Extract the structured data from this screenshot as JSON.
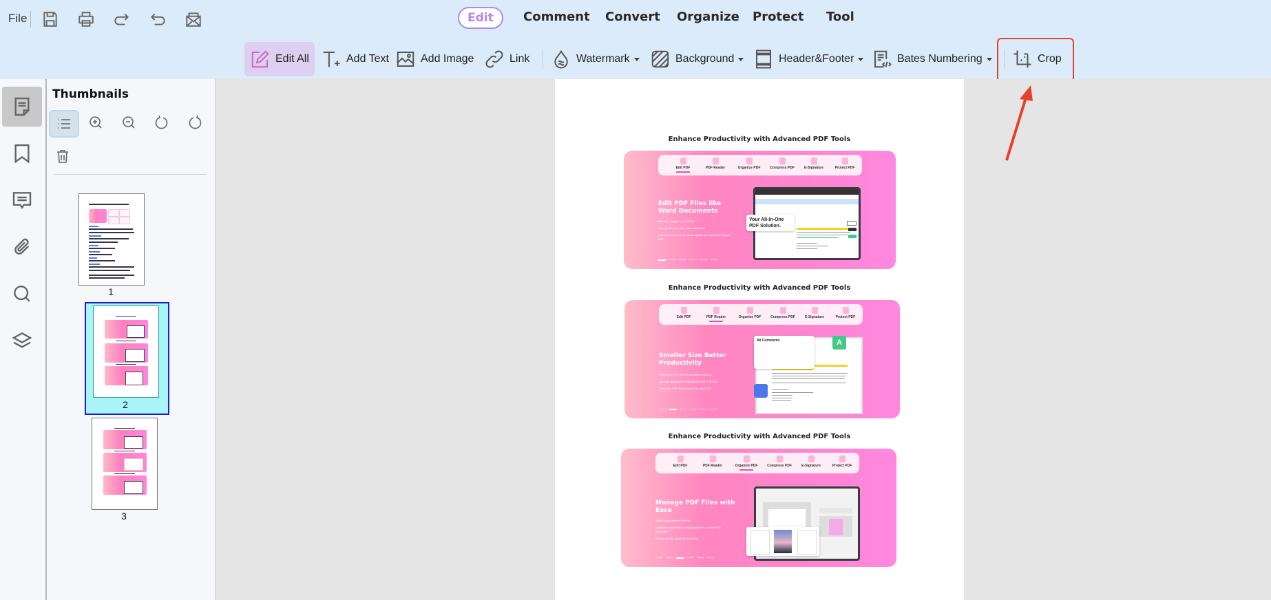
{
  "quickbar": {
    "file_label": "File",
    "icons": [
      "save-icon",
      "print-icon",
      "redo-icon",
      "undo-icon",
      "email-icon"
    ]
  },
  "menu": {
    "items": [
      {
        "label": "Edit",
        "active": true
      },
      {
        "label": "Comment"
      },
      {
        "label": "Convert"
      },
      {
        "label": "Organize"
      },
      {
        "label": "Protect"
      },
      {
        "label": "Tool"
      }
    ]
  },
  "toolbar": {
    "edit_all": "Edit All",
    "add_text": "Add Text",
    "add_image": "Add Image",
    "link": "Link",
    "watermark": "Watermark",
    "background": "Background",
    "header_footer": "Header&Footer",
    "bates_numbering": "Bates Numbering",
    "crop": "Crop",
    "highlight_color": "#e8402a"
  },
  "sidebar": {
    "rail": [
      "thumbnails",
      "bookmarks",
      "comments",
      "attachments",
      "search",
      "layers"
    ],
    "active": "thumbnails"
  },
  "thumbnails_panel": {
    "title": "Thumbnails",
    "pages": [
      {
        "number": "1"
      },
      {
        "number": "2",
        "selected": true
      },
      {
        "number": "3"
      }
    ]
  },
  "document": {
    "sections": [
      {
        "title": "Enhance Productivity with Advanced PDF Tools",
        "tabs": [
          "Edit PDF",
          "PDF Reader",
          "Organize PDF",
          "Compress PDF",
          "E-Signature",
          "Protect PDF"
        ],
        "current_tab": 0,
        "heading": "Edit PDF Files like Word Documents",
        "bullets": [
          "Edit text, images in a PDF file.",
          "Change the font style, colors, and size.",
          "Add or remove text, to edit or update and a cohesive layout PDF."
        ],
        "callout": "Your All-In-One PDF Solution."
      },
      {
        "title": "Enhance Productivity with Advanced PDF Tools",
        "tabs": [
          "Edit PDF",
          "PDF Reader",
          "Organize PDF",
          "Compress PDF",
          "E-Signature",
          "Protect PDF"
        ],
        "current_tab": 1,
        "heading": "Smaller Size Better Productivity",
        "bullets": [
          "Reduce the PDF file size for easier sharing.",
          "Optimize storage by compressing bulk PDF files.",
          "Compress PDF itself instead of using OCR."
        ],
        "callout": "All Comments"
      },
      {
        "title": "Enhance Productivity with Advanced PDF Tools",
        "tabs": [
          "Edit PDF",
          "PDF Reader",
          "Organize PDF",
          "Compress PDF",
          "E-Signature",
          "Protect PDF"
        ],
        "current_tab": 2,
        "heading": "Manage PDF Files with Ease",
        "bullets": [
          "Adjust page order of PDF file.",
          "Combine multiple files or split pages into a better PDF document.",
          "Extract specific pages to a new file."
        ],
        "callout": ""
      }
    ]
  }
}
